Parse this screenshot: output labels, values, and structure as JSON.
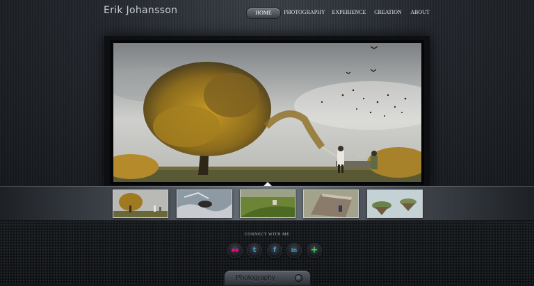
{
  "site": {
    "name": "Erik Johansson"
  },
  "nav": {
    "items": [
      {
        "label": "HOME",
        "active": true
      },
      {
        "label": "PHOTOGRAPHY",
        "active": false
      },
      {
        "label": "EXPERIENCE",
        "active": false
      },
      {
        "label": "CREATION",
        "active": false
      },
      {
        "label": "ABOUT",
        "active": false
      }
    ]
  },
  "gallery": {
    "main_image": "autumn-tree-leaves-net-photo",
    "thumbnails": [
      {
        "image": "autumn-tree-thumbnail"
      },
      {
        "image": "falling-man-thumbnail"
      },
      {
        "image": "green-field-thumbnail"
      },
      {
        "image": "folded-road-thumbnail"
      },
      {
        "image": "floating-island-thumbnail"
      }
    ]
  },
  "social": {
    "heading": "CONNECT WITH ME",
    "buttons": [
      {
        "icon": "flickr-icon",
        "glyph": "●●",
        "color": "#ff0084"
      },
      {
        "icon": "tumblr-icon",
        "glyph": "t",
        "color": "#3b9ed8"
      },
      {
        "icon": "facebook-icon",
        "glyph": "f",
        "color": "#3b9ed8"
      },
      {
        "icon": "linkedin-icon",
        "glyph": "in",
        "color": "#3b9ed8"
      },
      {
        "icon": "plus-icon",
        "glyph": "+",
        "color": "#3bd84a"
      }
    ]
  },
  "footer_tab": {
    "label": "Photography"
  },
  "colors": {
    "accent_text": "#e2e4e7",
    "background": "#16191d"
  }
}
